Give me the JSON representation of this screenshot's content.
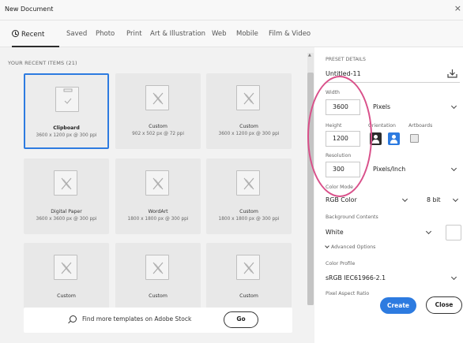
{
  "window": {
    "title": "New Document",
    "close_glyph": "×"
  },
  "tabs": [
    {
      "label": "Recent",
      "active": true
    },
    {
      "label": "Saved"
    },
    {
      "label": "Photo"
    },
    {
      "label": "Print"
    },
    {
      "label": "Art & Illustration"
    },
    {
      "label": "Web"
    },
    {
      "label": "Mobile"
    },
    {
      "label": "Film & Video"
    }
  ],
  "recent": {
    "header": "YOUR RECENT ITEMS  (21)",
    "items": [
      {
        "name": "Clipboard",
        "dims": "3600 x 1200 px @ 300 ppi",
        "icon": "clipboard-doc-icon",
        "selected": true
      },
      {
        "name": "Custom",
        "dims": "902 x 502 px @ 72 ppi",
        "icon": "custom-doc-icon"
      },
      {
        "name": "Custom",
        "dims": "3600 x 1200 px @ 300 ppi",
        "icon": "custom-doc-icon"
      },
      {
        "name": "Digital Paper",
        "dims": "3600 x 3600 px @ 300 ppi",
        "icon": "custom-doc-icon"
      },
      {
        "name": "WordArt",
        "dims": "1800 x 1800 px @ 300 ppi",
        "icon": "custom-doc-icon"
      },
      {
        "name": "Custom",
        "dims": "1800 x 1800 px @ 300 ppi",
        "icon": "custom-doc-icon"
      },
      {
        "name": "Custom",
        "dims": "",
        "icon": "custom-doc-icon"
      },
      {
        "name": "Custom",
        "dims": "",
        "icon": "custom-doc-icon"
      },
      {
        "name": "Custom",
        "dims": "",
        "icon": "custom-doc-icon"
      }
    ]
  },
  "stock": {
    "text": "Find more templates on Adobe Stock",
    "go_label": "Go"
  },
  "preset": {
    "header": "PRESET DETAILS",
    "name": "Untitled-11",
    "width_label": "Width",
    "width_value": "3600",
    "width_unit": "Pixels",
    "height_label": "Height",
    "height_value": "1200",
    "orientation_label": "Orientation",
    "artboards_label": "Artboards",
    "resolution_label": "Resolution",
    "resolution_value": "300",
    "resolution_unit": "Pixels/Inch",
    "color_mode_label": "Color Mode",
    "color_mode_value": "RGB Color",
    "bit_depth": "8 bit",
    "background_label": "Background Contents",
    "background_value": "White",
    "advanced_label": "Advanced Options",
    "color_profile_label": "Color Profile",
    "color_profile_value": "sRGB IEC61966-2.1",
    "pixel_aspect_label": "Pixel Aspect Ratio"
  },
  "buttons": {
    "create": "Create",
    "close": "Close"
  },
  "colors": {
    "accent": "#2d7be0",
    "annotation": "#d9508a"
  }
}
